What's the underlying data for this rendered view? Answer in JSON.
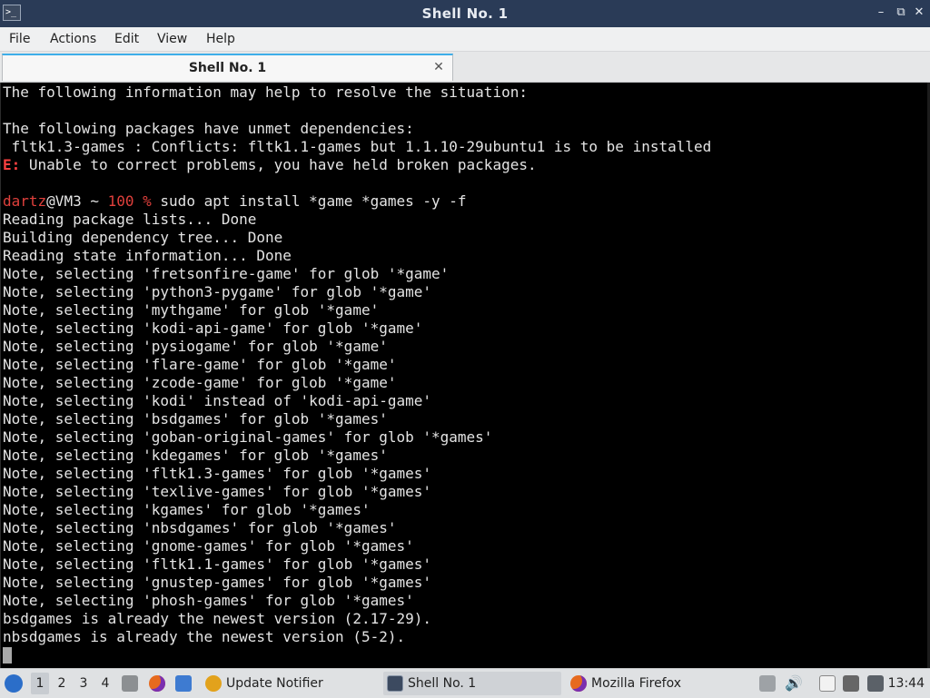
{
  "window": {
    "title": "Shell No. 1",
    "app_icon_glyph": ">_",
    "minimize_glyph": "–",
    "maximize_glyph": "⧉",
    "close_glyph": "✕"
  },
  "menu": [
    "File",
    "Actions",
    "Edit",
    "View",
    "Help"
  ],
  "tab": {
    "label": "Shell No. 1",
    "close_glyph": "✕"
  },
  "terminal": {
    "lines": [
      {
        "text": "The following information may help to resolve the situation:"
      },
      {
        "text": ""
      },
      {
        "text": "The following packages have unmet dependencies:"
      },
      {
        "text": " fltk1.3-games : Conflicts: fltk1.1-games but 1.1.10-29ubuntu1 is to be installed"
      },
      {
        "prefix": "E:",
        "text": " Unable to correct problems, you have held broken packages."
      },
      {
        "text": ""
      },
      {
        "prompt_user": "dartz",
        "prompt_host": "@VM3 ~ ",
        "prompt_status": "100 %",
        "prompt_cmd": " sudo apt install *game *games -y -f"
      },
      {
        "text": "Reading package lists... Done"
      },
      {
        "text": "Building dependency tree... Done"
      },
      {
        "text": "Reading state information... Done"
      },
      {
        "text": "Note, selecting 'fretsonfire-game' for glob '*game'"
      },
      {
        "text": "Note, selecting 'python3-pygame' for glob '*game'"
      },
      {
        "text": "Note, selecting 'mythgame' for glob '*game'"
      },
      {
        "text": "Note, selecting 'kodi-api-game' for glob '*game'"
      },
      {
        "text": "Note, selecting 'pysiogame' for glob '*game'"
      },
      {
        "text": "Note, selecting 'flare-game' for glob '*game'"
      },
      {
        "text": "Note, selecting 'zcode-game' for glob '*game'"
      },
      {
        "text": "Note, selecting 'kodi' instead of 'kodi-api-game'"
      },
      {
        "text": "Note, selecting 'bsdgames' for glob '*games'"
      },
      {
        "text": "Note, selecting 'goban-original-games' for glob '*games'"
      },
      {
        "text": "Note, selecting 'kdegames' for glob '*games'"
      },
      {
        "text": "Note, selecting 'fltk1.3-games' for glob '*games'"
      },
      {
        "text": "Note, selecting 'texlive-games' for glob '*games'"
      },
      {
        "text": "Note, selecting 'kgames' for glob '*games'"
      },
      {
        "text": "Note, selecting 'nbsdgames' for glob '*games'"
      },
      {
        "text": "Note, selecting 'gnome-games' for glob '*games'"
      },
      {
        "text": "Note, selecting 'fltk1.1-games' for glob '*games'"
      },
      {
        "text": "Note, selecting 'gnustep-games' for glob '*games'"
      },
      {
        "text": "Note, selecting 'phosh-games' for glob '*games'"
      },
      {
        "text": "bsdgames is already the newest version (2.17-29)."
      },
      {
        "text": "nbsdgames is already the newest version (5-2)."
      }
    ]
  },
  "taskbar": {
    "desktops": [
      "1",
      "2",
      "3",
      "4"
    ],
    "active_desktop": "1",
    "tasks": [
      {
        "label": "Update Notifier",
        "icon": "update-notifier-icon"
      },
      {
        "label": "Shell No. 1",
        "icon": "terminal-icon"
      },
      {
        "label": "Mozilla Firefox",
        "icon": "firefox-icon"
      }
    ],
    "clock": "13:44"
  },
  "colors": {
    "titlebar": "#2a3b57",
    "accent": "#3daee9",
    "prompt_red": "#e0403c",
    "terminal_bg": "#000000",
    "terminal_fg": "#e4e4e4"
  }
}
